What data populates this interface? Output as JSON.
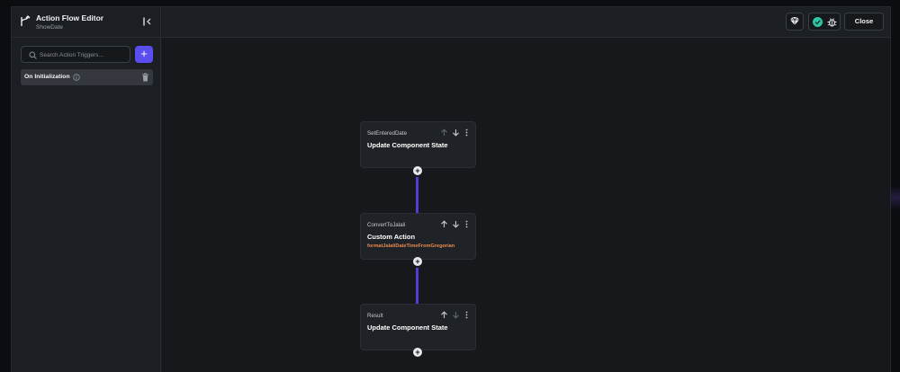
{
  "header": {
    "title": "Action Flow Editor",
    "subtitle": "ShowDate"
  },
  "search": {
    "placeholder": "Search Action Triggers..."
  },
  "add_button": "+",
  "triggers": [
    {
      "label": "On Initialization"
    }
  ],
  "topbar": {
    "close_label": "Close"
  },
  "nodes": [
    {
      "name": "SetEnteredDate",
      "title": "Update Component State",
      "subtitle": ""
    },
    {
      "name": "ConvertToJalali",
      "title": "Custom Action",
      "subtitle": "formatJalaliDateTimeFromGregorian"
    },
    {
      "name": "Result",
      "title": "Update Component State",
      "subtitle": ""
    }
  ],
  "plus_label": "+",
  "colors": {
    "accent": "#5b4ef0",
    "connector": "#4d3fd8",
    "subtitle_orange": "#e98b4e",
    "check_green": "#2ec4a4"
  }
}
